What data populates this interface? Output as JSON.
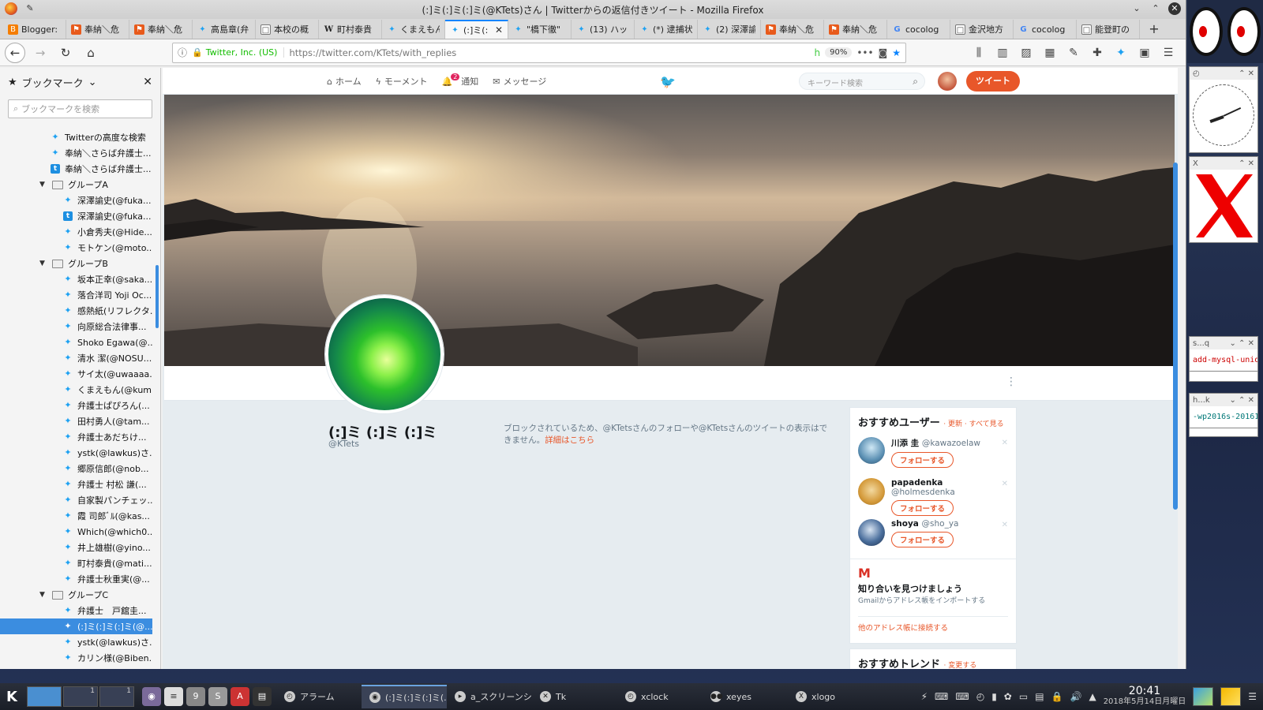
{
  "window": {
    "title": "(:]ミ(:]ミ(:]ミ(@KTets)さん | Twitterからの返信付きツイート - Mozilla Firefox"
  },
  "tabs": [
    {
      "icon": "blogger",
      "label": "Blogger:"
    },
    {
      "icon": "blog",
      "label": "奉納＼危"
    },
    {
      "icon": "blog",
      "label": "奉納＼危"
    },
    {
      "icon": "twitter",
      "label": "高島章(弁"
    },
    {
      "icon": "doc",
      "label": "本校の概"
    },
    {
      "icon": "wiki",
      "label": "町村泰貴"
    },
    {
      "icon": "twitter",
      "label": "くまえもん"
    },
    {
      "icon": "twitter",
      "label": "(:]ミ(:",
      "active": true
    },
    {
      "icon": "twitter",
      "label": "\"橋下徹\""
    },
    {
      "icon": "twitter",
      "label": "(13) ハッ"
    },
    {
      "icon": "twitter",
      "label": "(*) 逮捕状"
    },
    {
      "icon": "twitter",
      "label": "(2) 深澤諭"
    },
    {
      "icon": "blog",
      "label": "奉納＼危"
    },
    {
      "icon": "blog",
      "label": "奉納＼危"
    },
    {
      "icon": "google",
      "label": "cocolog"
    },
    {
      "icon": "doc",
      "label": "金沢地方"
    },
    {
      "icon": "google",
      "label": "cocolog"
    },
    {
      "icon": "doc",
      "label": "能登町の"
    }
  ],
  "navbar": {
    "identity": "Twitter, Inc. (US)",
    "url": "https://twitter.com/KTets/with_replies",
    "zoom": "90%"
  },
  "sidebar": {
    "title": "ブックマーク",
    "search_placeholder": "ブックマークを検索",
    "items": [
      {
        "level": 1,
        "type": "tw",
        "label": "Twitterの高度な検索"
      },
      {
        "level": 1,
        "type": "tw",
        "label": "奉納＼さらば弁護士..."
      },
      {
        "level": 1,
        "type": "t",
        "label": "奉納＼さらば弁護士..."
      },
      {
        "level": 0,
        "type": "folder",
        "label": "グループA"
      },
      {
        "level": 2,
        "type": "tw",
        "label": "深澤諭史(@fuka..."
      },
      {
        "level": 2,
        "type": "t",
        "label": "深澤諭史(@fuka..."
      },
      {
        "level": 2,
        "type": "tw",
        "label": "小倉秀夫(@Hide..."
      },
      {
        "level": 2,
        "type": "tw",
        "label": "モトケン(@moto..."
      },
      {
        "level": 0,
        "type": "folder",
        "label": "グループB"
      },
      {
        "level": 2,
        "type": "tw",
        "label": "坂本正幸(@saka..."
      },
      {
        "level": 2,
        "type": "tw",
        "label": "落合洋司 Yoji Oc..."
      },
      {
        "level": 2,
        "type": "tw",
        "label": "感熱紙(リフレクタ..."
      },
      {
        "level": 2,
        "type": "tw",
        "label": "向原総合法律事..."
      },
      {
        "level": 2,
        "type": "tw",
        "label": "Shoko Egawa(@..."
      },
      {
        "level": 2,
        "type": "tw",
        "label": "清水 潔(@NOSU..."
      },
      {
        "level": 2,
        "type": "tw",
        "label": "サイ太(@uwaaaa..."
      },
      {
        "level": 2,
        "type": "tw",
        "label": "くまえもん(@kum..."
      },
      {
        "level": 2,
        "type": "tw",
        "label": "弁護士ぱぴろん(..."
      },
      {
        "level": 2,
        "type": "tw",
        "label": "田村勇人(@tam..."
      },
      {
        "level": 2,
        "type": "tw",
        "label": "弁護士あだちけ..."
      },
      {
        "level": 2,
        "type": "tw",
        "label": "ystk(@lawkus)さ..."
      },
      {
        "level": 2,
        "type": "tw",
        "label": "郷原信郎(@nob..."
      },
      {
        "level": 2,
        "type": "tw",
        "label": "弁護士 村松 謙(..."
      },
      {
        "level": 2,
        "type": "tw",
        "label": "自家製パンチェッ..."
      },
      {
        "level": 2,
        "type": "tw",
        "label": "霞 司郎ﾞﾙ(@kas..."
      },
      {
        "level": 2,
        "type": "tw",
        "label": "Which(@which0..."
      },
      {
        "level": 2,
        "type": "tw",
        "label": "井上雄樹(@yino..."
      },
      {
        "level": 2,
        "type": "tw",
        "label": "町村泰貴(@mati..."
      },
      {
        "level": 2,
        "type": "tw",
        "label": "弁護士秋重実(@..."
      },
      {
        "level": 0,
        "type": "folder",
        "label": "グループC"
      },
      {
        "level": 2,
        "type": "tw",
        "label": "弁護士　戸舘圭..."
      },
      {
        "level": 2,
        "type": "tw",
        "label": "(:]ミ(:]ミ(:]ミ(@...",
        "selected": true
      },
      {
        "level": 2,
        "type": "tw",
        "label": "ystk(@lawkus)さ..."
      },
      {
        "level": 2,
        "type": "tw",
        "label": "カリン様(@Biben..."
      }
    ]
  },
  "twitter": {
    "nav": {
      "home": "ホーム",
      "moments": "モーメント",
      "notifications": "通知",
      "notif_count": "2",
      "messages": "メッセージ"
    },
    "search_placeholder": "キーワード検索",
    "tweet_button": "ツイート",
    "profile": {
      "name": "(:]ミ (:]ミ (:]ミ",
      "handle": "@KTets"
    },
    "blocked_message": "ブロックされているため、@KTetsさんのフォローや@KTetsさんのツイートの表示はできません。",
    "blocked_link": "詳細はこちら",
    "recommend": {
      "title": "おすすめユーザー",
      "links": "· 更新 · すべて見る",
      "follow_label": "フォローする",
      "users": [
        {
          "name": "川添 圭",
          "handle": "@kawazoelaw"
        },
        {
          "name": "papadenka",
          "handle": "@holmesdenka"
        },
        {
          "name": "shoya",
          "handle": "@sho_ya"
        }
      ],
      "gmail_title": "知り合いを見つけましょう",
      "gmail_sub": "Gmailからアドレス帳をインポートする",
      "other_link": "他のアドレス帳に接続する"
    },
    "trends_title": "おすすめトレンド",
    "trends_link": "· 変更する"
  },
  "desktop": {
    "term1_text": "add-mysql-uniq.rb",
    "term2_text": "-wp2016s-20161",
    "term1_title": "s...q",
    "term2_title": "h...k"
  },
  "taskbar": {
    "pager": [
      "1",
      "1"
    ],
    "tasks": [
      {
        "icon": "clock",
        "label": "アラーム"
      },
      {
        "icon": "firefox",
        "label": "(:]ミ(:]ミ(:]ミ(..."
      },
      {
        "icon": "terminal",
        "label": "a_スクリーンシ..."
      },
      {
        "icon": "tk",
        "label": "Tk"
      },
      {
        "icon": "clock",
        "label": "xclock"
      },
      {
        "icon": "eyes",
        "label": "xeyes"
      },
      {
        "icon": "x",
        "label": "xlogo"
      }
    ],
    "time": "20:41",
    "date": "2018年5月14日月曜日"
  }
}
